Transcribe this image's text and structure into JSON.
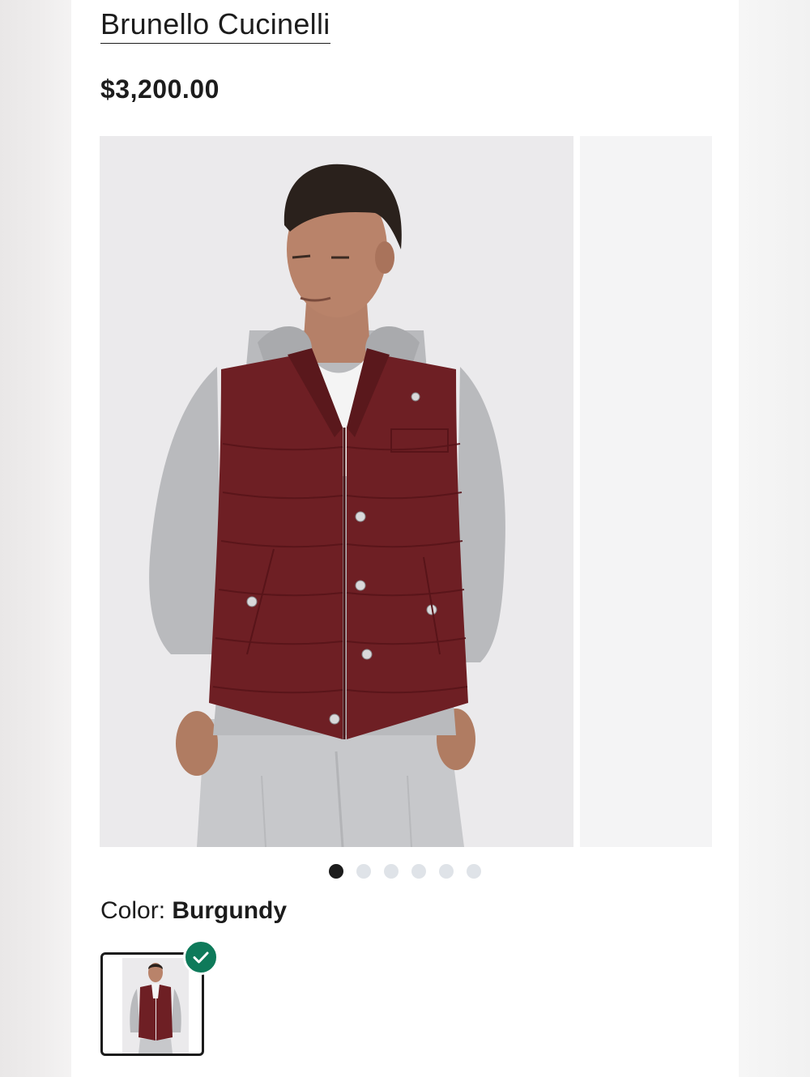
{
  "product": {
    "brand": "Brunello Cucinelli",
    "price": "$3,200.00"
  },
  "gallery": {
    "slide_count": 6,
    "active_index": 0,
    "image_alt": "Model wearing burgundy quilted down vest over grey hoodie"
  },
  "color": {
    "label": "Color:",
    "value": "Burgundy"
  },
  "colors": {
    "vest": "#6e1f24",
    "hoodie": "#b9babd",
    "selected_check": "#0e7a5a"
  }
}
